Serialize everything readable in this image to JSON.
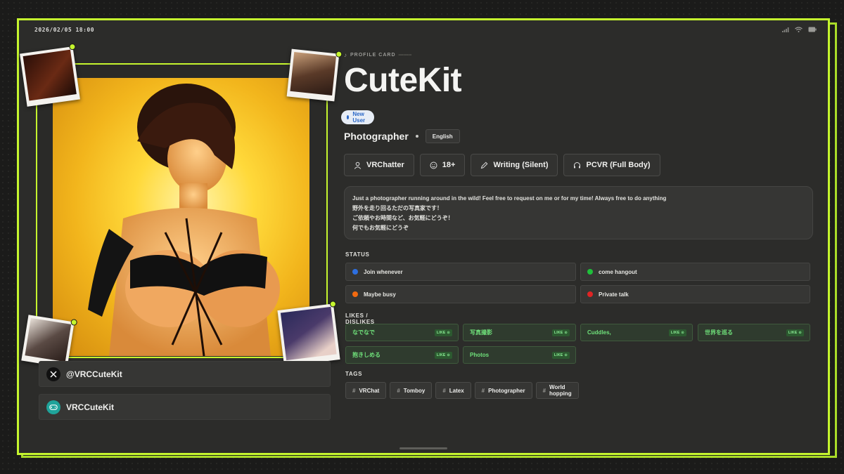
{
  "status_bar": {
    "time": "2026/02/05 18:00",
    "icons": [
      "signal-icon",
      "wifi-icon",
      "battery-icon"
    ]
  },
  "profile": {
    "kicker": "PROFILE CARD",
    "kicker_dash": "--------",
    "name": "CuteKit",
    "badge": "New User",
    "role": "Photographer",
    "language": "English",
    "chips": [
      {
        "icon": "user-icon",
        "label": "VRChatter"
      },
      {
        "icon": "age-icon",
        "label": "18+"
      },
      {
        "icon": "pen-icon",
        "label": "Writing (Silent)"
      },
      {
        "icon": "headset-icon",
        "label": "PCVR (Full Body)"
      }
    ],
    "bio": [
      "Just a photographer running around in the wild! Feel free to request on me or for my time! Always free to do anything",
      "野外を走り回るただの写真家です！",
      "ご依頼やお時間など、お気軽にどうぞ！",
      "何でもお気軽にどうぞ"
    ]
  },
  "social": {
    "twitter": "@VRCCuteKit",
    "vrchat": "VRCCuteKit"
  },
  "status": {
    "title": "STATUS",
    "items": [
      {
        "label": "Join whenever",
        "color": "#2d6fe0"
      },
      {
        "label": "come hangout",
        "color": "#1fbf3a"
      },
      {
        "label": "Maybe busy",
        "color": "#f26a10"
      },
      {
        "label": "Private talk",
        "color": "#e02424"
      }
    ]
  },
  "likes": {
    "title": "LIKES / DISLIKES",
    "badge": "LIKE",
    "items": [
      "なでなで",
      "写真撮影",
      "Cuddles,",
      "世界を巡る",
      "抱きしめる",
      "Photos"
    ]
  },
  "tags": {
    "title": "TAGS",
    "items": [
      "VRChat",
      "Tomboy",
      "Latex",
      "Photographer",
      "World hopping"
    ]
  },
  "colors": {
    "accent": "#c5f52e",
    "background": "#2c2c2a",
    "like_text": "#6fe07a"
  }
}
